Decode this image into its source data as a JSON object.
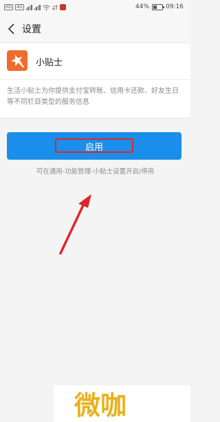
{
  "status_bar": {
    "left_tags": [
      "HD",
      "4G"
    ],
    "battery_percent": "44%",
    "battery_level": 0.44,
    "time": "09:16"
  },
  "nav": {
    "title": "设置",
    "icons": {
      "back": "back-chevron-icon"
    }
  },
  "tip_card": {
    "app_name": "小贴士",
    "icon_name": "star-magic-icon",
    "description": "生活小贴士为你提供支付宝转账、信用卡还款、好友生日等不同栏目类型的服务信息"
  },
  "enable_button": {
    "label": "启用"
  },
  "hint": "可在通用-功能管理-小贴士设置开启/停用",
  "watermark": {
    "text": "微咖"
  },
  "colors": {
    "primary_button": "#1a8eea",
    "app_icon": "#f06b2c",
    "annotation": "#e0262b"
  }
}
